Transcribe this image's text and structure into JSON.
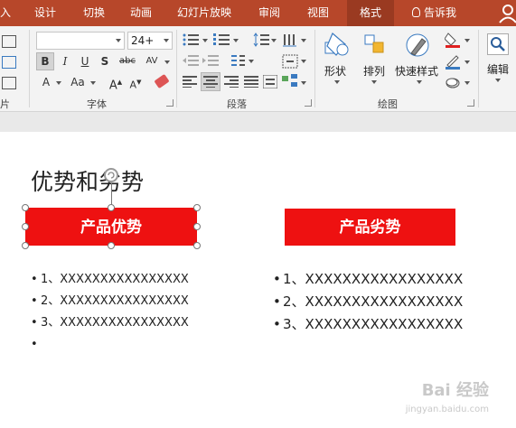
{
  "tabs": [
    "入",
    "设计",
    "切换",
    "动画",
    "幻灯片放映",
    "审阅",
    "视图",
    "格式",
    "告诉我"
  ],
  "ribbon": {
    "font_name": "",
    "font_size": "24+",
    "fmt_buttons": [
      "B",
      "I",
      "U",
      "S",
      "abc",
      "AV"
    ],
    "font_label": "字体",
    "para_label": "段落",
    "draw_label": "绘图",
    "shape_label": "形状",
    "arrange_label": "排列",
    "quick_style_label": "快速样式",
    "edit_label": "编辑",
    "left_cut_label": "片",
    "aa_large": "A",
    "aa_aa": "Aa",
    "font_color": "A"
  },
  "colors": {
    "accent": "#b7472a",
    "box_red": "#ee1111"
  },
  "slide": {
    "title": "优势和劣势",
    "left_box": "产品优势",
    "right_box": "产品劣势",
    "left_items": [
      "1、XXXXXXXXXXXXXXXX",
      "2、XXXXXXXXXXXXXXXX",
      "3、XXXXXXXXXXXXXXXX",
      ""
    ],
    "right_items": [
      "1、XXXXXXXXXXXXXXXXX",
      "2、XXXXXXXXXXXXXXXXX",
      "3、XXXXXXXXXXXXXXXXX"
    ]
  },
  "watermark": {
    "text": "Bai  经验",
    "sub": "jingyan.baidu.com"
  }
}
